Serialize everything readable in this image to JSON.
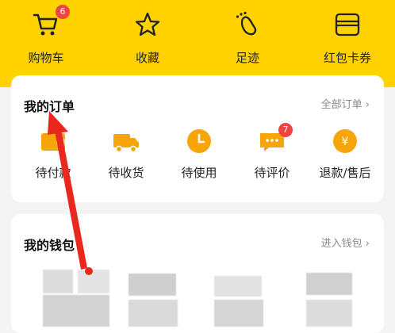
{
  "top_nav": {
    "items": [
      {
        "label": "购物车",
        "icon": "cart-icon",
        "badge": "6"
      },
      {
        "label": "收藏",
        "icon": "star-icon",
        "badge": ""
      },
      {
        "label": "足迹",
        "icon": "footprint-icon",
        "badge": ""
      },
      {
        "label": "红包卡券",
        "icon": "wallet-card-icon",
        "badge": ""
      }
    ]
  },
  "orders": {
    "title": "我的订单",
    "more": "全部订单 ›",
    "items": [
      {
        "label": "待付款",
        "icon": "wallet-icon"
      },
      {
        "label": "待收货",
        "icon": "truck-icon"
      },
      {
        "label": "待使用",
        "icon": "clock-icon"
      },
      {
        "label": "待评价",
        "icon": "comment-icon",
        "badge": "7"
      },
      {
        "label": "退款/售后",
        "icon": "refund-icon"
      }
    ]
  },
  "wallet": {
    "title": "我的钱包",
    "more": "进入钱包 ›"
  },
  "colors": {
    "brand_yellow": "#ffd200",
    "icon_orange": "#f7a60a",
    "badge_red": "#f04343",
    "annotation_red": "#e8281e"
  }
}
